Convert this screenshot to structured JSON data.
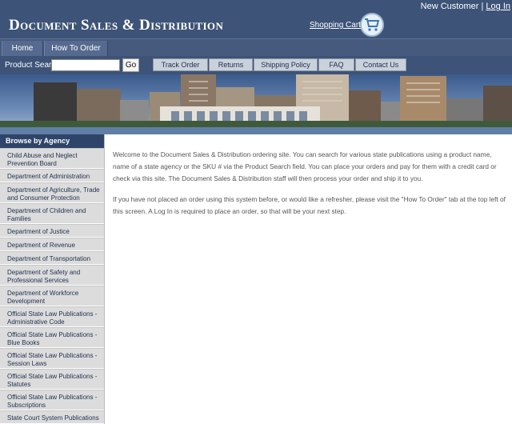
{
  "header": {
    "title": "Document Sales & Distribution",
    "new_customer": "New Customer",
    "separator": "|",
    "login": "Log In",
    "cart_label": "Shopping Cart",
    "cart_icon": "shopping-cart-icon"
  },
  "nav": {
    "home": "Home",
    "how_to_order": "How To Order"
  },
  "search": {
    "label": "Product Search:",
    "value": "",
    "go": "Go"
  },
  "subnav": [
    "Track Order",
    "Returns",
    "Shipping Policy",
    "FAQ",
    "Contact Us"
  ],
  "sidebar": {
    "heading": "Browse by Agency",
    "items": [
      "Child Abuse and Neglect Prevention Board",
      "Department of Administration",
      "Department of Agriculture, Trade and Consumer Protection",
      "Department of Children and Families",
      "Department of Justice",
      "Department of Revenue",
      "Department of Transportation",
      "Department of Safety and Professional Services",
      "Department of Workforce Development",
      "Official State Law Publications - Administrative Code",
      "Official State Law Publications - Blue Books",
      "Official State Law Publications - Session Laws",
      "Official State Law Publications - Statutes",
      "Official State Law Publications - Subscriptions",
      "State Court System Publications"
    ]
  },
  "content": {
    "p1": "Welcome to the Document Sales & Distribution ordering site.  You can search for various state publications using a product name, name of a state agency or the SKU # via the Product Search field.  You can place your orders and pay for them with a credit card or check via this site.  The Document Sales & Distribution staff will then process your order and ship it to you.",
    "p2": "If you have not placed an order using this system before, or would like a refresher, please visit the \"How To Order\" tab at the top left of this screen.  A Log In is required to place an order, so that will be your next step."
  },
  "colors": {
    "header_bg": "#3d5377",
    "sidebar_head": "#2e4468",
    "sidebar_item": "#dcdcdc"
  }
}
